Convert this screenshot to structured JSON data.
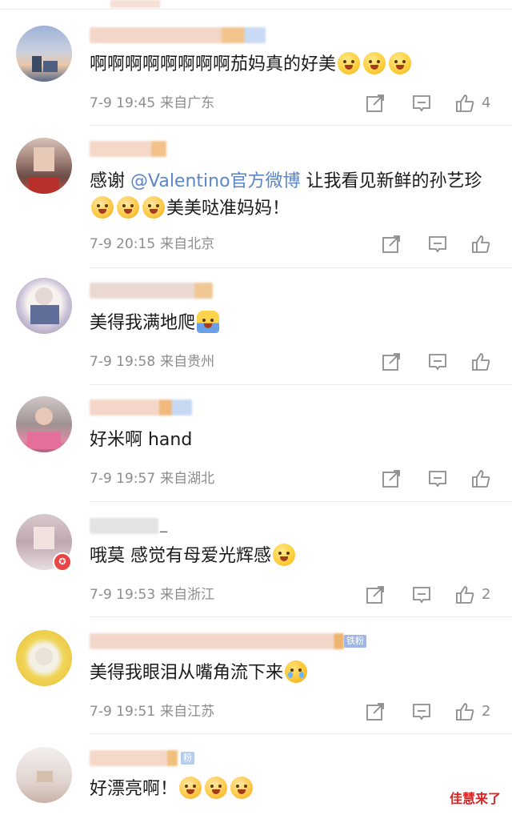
{
  "comments": [
    {
      "text": "啊啊啊啊啊啊啊啊茄妈真的好美",
      "emojis": [
        "grin-sweat-icon",
        "grin-sweat-icon",
        "grin-sweat-icon"
      ],
      "date": "7-9 19:45",
      "location": "来自广东",
      "likes": "4"
    },
    {
      "text_before": "感谢 ",
      "mention": "@Valentino官方微博",
      "text_after": " 让我看见新鲜的孙艺珍",
      "text_tail": "美美哒准妈妈！",
      "emojis": [
        "heart-smile-icon",
        "heart-smile-icon",
        "heart-smile-icon"
      ],
      "date": "7-9 20:15",
      "location": "来自北京",
      "likes": ""
    },
    {
      "text": "美得我满地爬",
      "emojis": [
        "crawling-figure-icon"
      ],
      "date": "7-9 19:58",
      "location": "来自贵州",
      "likes": ""
    },
    {
      "text": "好米啊 hand",
      "emojis": [],
      "date": "7-9 19:57",
      "location": "来自湖北",
      "likes": ""
    },
    {
      "name_suffix": "_",
      "text": "哦莫 感觉有母爱光辉感",
      "emojis": [
        "shocked-face-icon"
      ],
      "date": "7-9 19:53",
      "location": "来自浙江",
      "likes": "2"
    },
    {
      "fan_tag": "铁粉",
      "text": "美得我眼泪从嘴角流下来",
      "emojis": [
        "crying-face-icon"
      ],
      "date": "7-9 19:51",
      "location": "来自江苏",
      "likes": "2"
    },
    {
      "fan_tag": "粉",
      "text": "好漂亮啊！",
      "emojis": [
        "heart-smile-icon",
        "heart-smile-icon",
        "heart-smile-icon"
      ],
      "date": "",
      "location": "",
      "likes": ""
    }
  ],
  "watermark": "佳慧来了",
  "colors": {
    "text": "#1a1a1a",
    "meta": "#8c8c8c",
    "mention": "#5b86c6",
    "separator": "#eaeaea",
    "badge": "#e84545"
  }
}
